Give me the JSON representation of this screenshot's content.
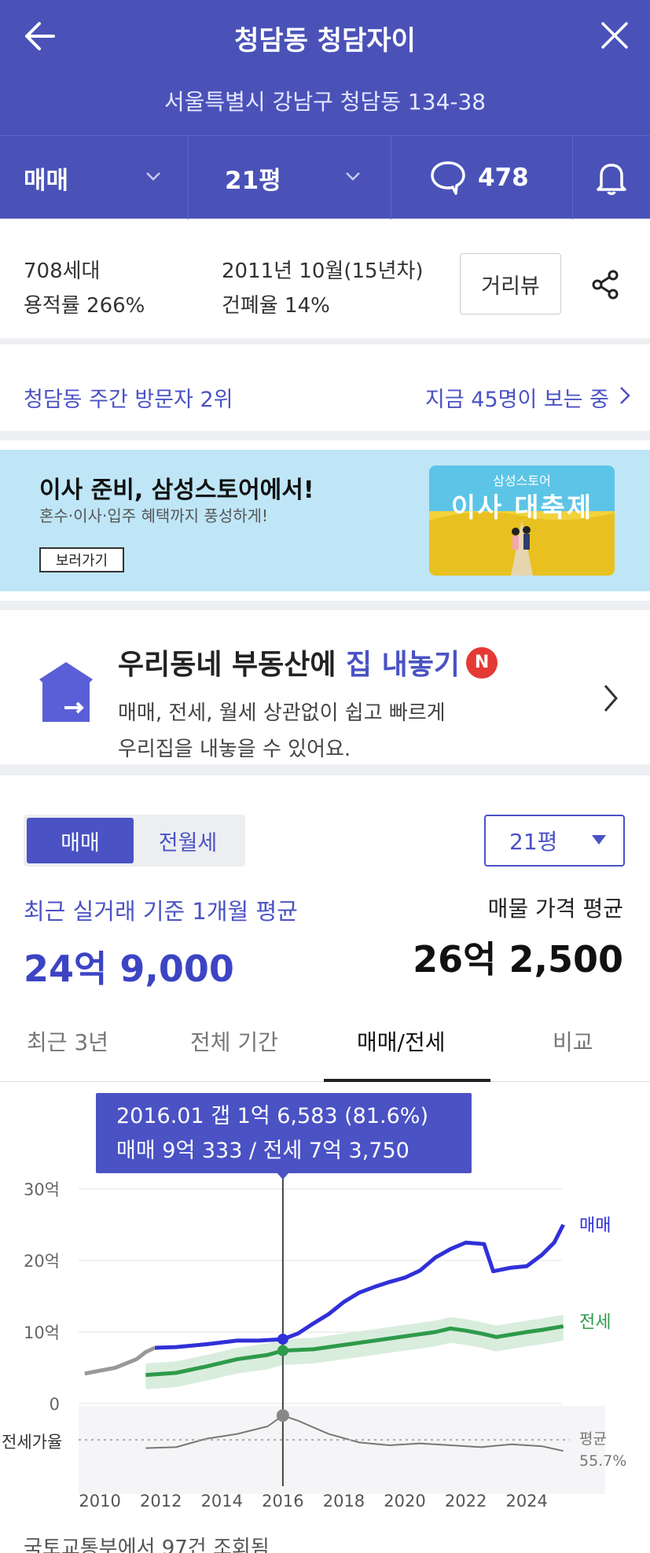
{
  "header": {
    "title": "청담동 청담자이",
    "address": "서울특별시 강남구 청담동 134-38",
    "trade_type": "매매",
    "pyeong": "21평",
    "comment_count": "478"
  },
  "info": {
    "households": "708세대",
    "far": "용적률 266%",
    "built": "2011년 10월(15년차)",
    "bcr": "건폐율 14%",
    "street_view": "거리뷰"
  },
  "visitors": {
    "rank": "청담동 주간 방문자 2위",
    "viewing": "지금 45명이 보는 중"
  },
  "ad": {
    "headline": "이사 준비, 삼성스토어에서!",
    "sub": "혼수·이사·입주 혜택까지 풍성하게!",
    "button": "보러가기",
    "image_small": "삼성스토어",
    "image_big": "이사 대축제"
  },
  "sell_banner": {
    "title_prefix": "우리동네 부동산에 ",
    "title_highlight": "집 내놓기",
    "badge": "N",
    "desc1": "매매, 전세, 월세 상관없이 쉽고 빠르게",
    "desc2": "우리집을 내놓을 수 있어요."
  },
  "price": {
    "toggle_on": "매매",
    "toggle_off": "전월세",
    "pyeong_select": "21평",
    "recent_label": "최근 실거래 기준 1개월 평균",
    "recent_value": "24억 9,000",
    "listing_label": "매물 가격 평균",
    "listing_value": "26억 2,500"
  },
  "tabs": [
    "최근 3년",
    "전체 기간",
    "매매/전세",
    "비교"
  ],
  "tooltip": {
    "line1": "2016.01  갭 1억 6,583 (81.6%)",
    "line2": "매매 9억 333 / 전세 7억 3,750"
  },
  "footer_text": "국토교통부에서 97건 조회됨",
  "colors": {
    "header": "#4a52b8",
    "accent": "#4a52c4",
    "sale": "#3030d8",
    "jeonse": "#2e9a4a",
    "older": "#999999"
  },
  "chart_data": {
    "type": "line",
    "x_ticks": [
      "2010",
      "2012",
      "2014",
      "2016",
      "2018",
      "2020",
      "2022",
      "2024"
    ],
    "y_ticks": [
      "30억",
      "20억",
      "10억",
      "0"
    ],
    "ylim": [
      0,
      30
    ],
    "xlim": [
      2009.3,
      2025.8
    ],
    "series": [
      {
        "name": "매매",
        "unit": "억",
        "points": [
          [
            2009.5,
            4.2
          ],
          [
            2010.5,
            5.0
          ],
          [
            2011.2,
            6.2
          ],
          [
            2011.5,
            7.2
          ],
          [
            2011.8,
            7.8
          ],
          [
            2012.5,
            7.9
          ],
          [
            2013.5,
            8.3
          ],
          [
            2014.5,
            8.8
          ],
          [
            2015.2,
            8.8
          ],
          [
            2016.0,
            9.0
          ],
          [
            2016.5,
            9.8
          ],
          [
            2017.0,
            11.2
          ],
          [
            2017.5,
            12.5
          ],
          [
            2018.0,
            14.2
          ],
          [
            2018.5,
            15.5
          ],
          [
            2019.0,
            16.3
          ],
          [
            2019.5,
            17.0
          ],
          [
            2020.0,
            17.6
          ],
          [
            2020.5,
            18.6
          ],
          [
            2021.0,
            20.4
          ],
          [
            2021.5,
            21.6
          ],
          [
            2022.0,
            22.5
          ],
          [
            2022.6,
            22.3
          ],
          [
            2022.9,
            18.5
          ],
          [
            2023.5,
            19.0
          ],
          [
            2024.0,
            19.2
          ],
          [
            2024.5,
            20.8
          ],
          [
            2024.9,
            22.5
          ],
          [
            2025.2,
            25.0
          ]
        ]
      },
      {
        "name": "전세",
        "unit": "억",
        "points": [
          [
            2011.5,
            4.0
          ],
          [
            2012.5,
            4.3
          ],
          [
            2013.5,
            5.2
          ],
          [
            2014.5,
            6.2
          ],
          [
            2015.5,
            6.8
          ],
          [
            2016.0,
            7.4
          ],
          [
            2017.0,
            7.6
          ],
          [
            2018.0,
            8.2
          ],
          [
            2019.0,
            8.8
          ],
          [
            2020.0,
            9.4
          ],
          [
            2021.0,
            10.0
          ],
          [
            2021.5,
            10.5
          ],
          [
            2022.0,
            10.2
          ],
          [
            2022.5,
            9.8
          ],
          [
            2023.0,
            9.3
          ],
          [
            2024.0,
            10.0
          ],
          [
            2024.5,
            10.3
          ],
          [
            2025.2,
            10.8
          ]
        ]
      }
    ],
    "gap_ratio": {
      "label": "전세가율",
      "avg_label": "평균",
      "avg_value": "55.7%",
      "points": [
        [
          2011.5,
          47
        ],
        [
          2012.5,
          48
        ],
        [
          2013.5,
          57
        ],
        [
          2014.5,
          62
        ],
        [
          2015.5,
          70
        ],
        [
          2016.0,
          81.6
        ],
        [
          2016.5,
          76
        ],
        [
          2017.5,
          62
        ],
        [
          2018.5,
          53
        ],
        [
          2019.5,
          50
        ],
        [
          2020.5,
          52
        ],
        [
          2021.5,
          50
        ],
        [
          2022.5,
          48
        ],
        [
          2023.5,
          51
        ],
        [
          2024.5,
          49
        ],
        [
          2025.2,
          44
        ]
      ]
    },
    "highlight": {
      "x": 2016.0,
      "sale": 9.0,
      "jeonse": 7.4,
      "ratio": 81.6
    }
  }
}
